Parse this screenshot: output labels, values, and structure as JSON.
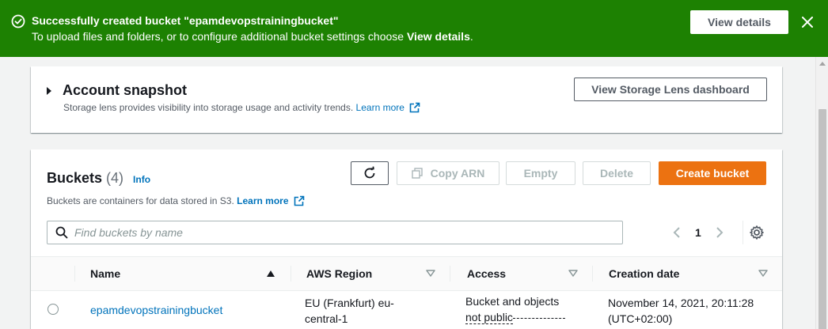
{
  "flash": {
    "title": "Successfully created bucket \"epamdevopstrainingbucket\"",
    "body_prefix": "To upload files and folders, or to configure additional bucket settings choose ",
    "body_bold": "View details",
    "body_suffix": ".",
    "button_label": "View details",
    "color": "#1d8102",
    "icon": "success-check-icon",
    "close_icon": "close-icon"
  },
  "snapshot": {
    "title": "Account snapshot",
    "description": "Storage lens provides visibility into storage usage and activity trends.",
    "learn_more": "Learn more",
    "button_label": "View Storage Lens dashboard"
  },
  "buckets": {
    "title": "Buckets",
    "count": "(4)",
    "info": "Info",
    "description": "Buckets are containers for data stored in S3.",
    "learn_more": "Learn more",
    "actions": {
      "refresh_icon": "refresh-icon",
      "copy_arn": "Copy ARN",
      "empty": "Empty",
      "delete": "Delete",
      "create": "Create bucket"
    },
    "search_placeholder": "Find buckets by name",
    "page": "1",
    "columns": [
      "Name",
      "AWS Region",
      "Access",
      "Creation date"
    ],
    "rows": [
      {
        "name": "epamdevopstrainingbucket",
        "region_line1": "EU (Frankfurt) eu-",
        "region_line2": "central-1",
        "access_line1": "Bucket and objects",
        "access_line2": "not public",
        "date_line1": "November 14, 2021, 20:11:28",
        "date_line2": "(UTC+02:00)"
      }
    ]
  },
  "colors": {
    "primary_button": "#ec7211",
    "link": "#0073bb",
    "success": "#1d8102"
  }
}
